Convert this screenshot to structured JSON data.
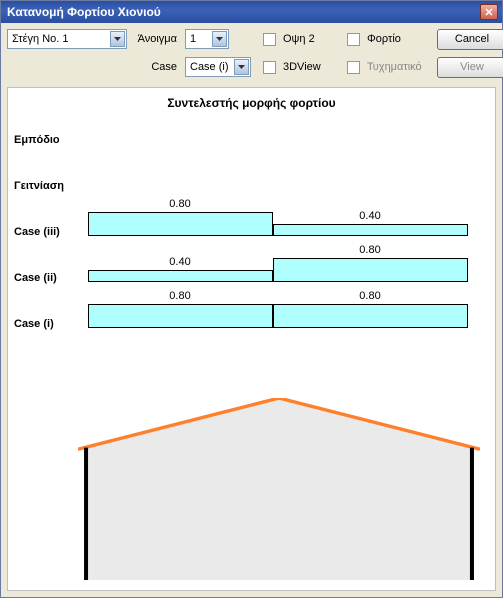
{
  "window": {
    "title": "Κατανομή Φορτίου Χιονιού"
  },
  "toolbar": {
    "roof_select": "Στέγη Νο. 1",
    "opening_label": "Άνοιγμα",
    "opening_value": "1",
    "case_label": "Case",
    "case_value": "Case (i)",
    "cb_opsi2": "Οψη 2",
    "cb_fortio": "Φορτίο",
    "cb_3dview": "3DView",
    "cb_tychimatiko": "Τυχηματικό",
    "btn_cancel": "Cancel",
    "btn_view": "View"
  },
  "chart": {
    "title": "Συντελεστής μορφής φορτίου",
    "rows": {
      "obstacle": "Εμπόδιο",
      "proximity": "Γειτνίαση",
      "case_iii": "Case (iii)",
      "case_ii": "Case (ii)",
      "case_i": "Case (i)"
    }
  },
  "chart_data": {
    "type": "bar",
    "title": "Συντελεστής μορφής φορτίου",
    "xlabel": "",
    "ylabel": "",
    "ylim": [
      0,
      1
    ],
    "categories": [
      "left",
      "right"
    ],
    "series": [
      {
        "name": "Εμπόδιο",
        "values": [
          null,
          null
        ]
      },
      {
        "name": "Γειτνίαση",
        "values": [
          null,
          null
        ]
      },
      {
        "name": "Case (iii)",
        "values": [
          0.8,
          0.4
        ]
      },
      {
        "name": "Case (ii)",
        "values": [
          0.4,
          0.8
        ]
      },
      {
        "name": "Case (i)",
        "values": [
          0.8,
          0.8
        ]
      }
    ]
  },
  "values": {
    "c3_left": "0.80",
    "c3_right": "0.40",
    "c2_left": "0.40",
    "c2_right": "0.80",
    "c1_left": "0.80",
    "c1_right": "0.80"
  }
}
